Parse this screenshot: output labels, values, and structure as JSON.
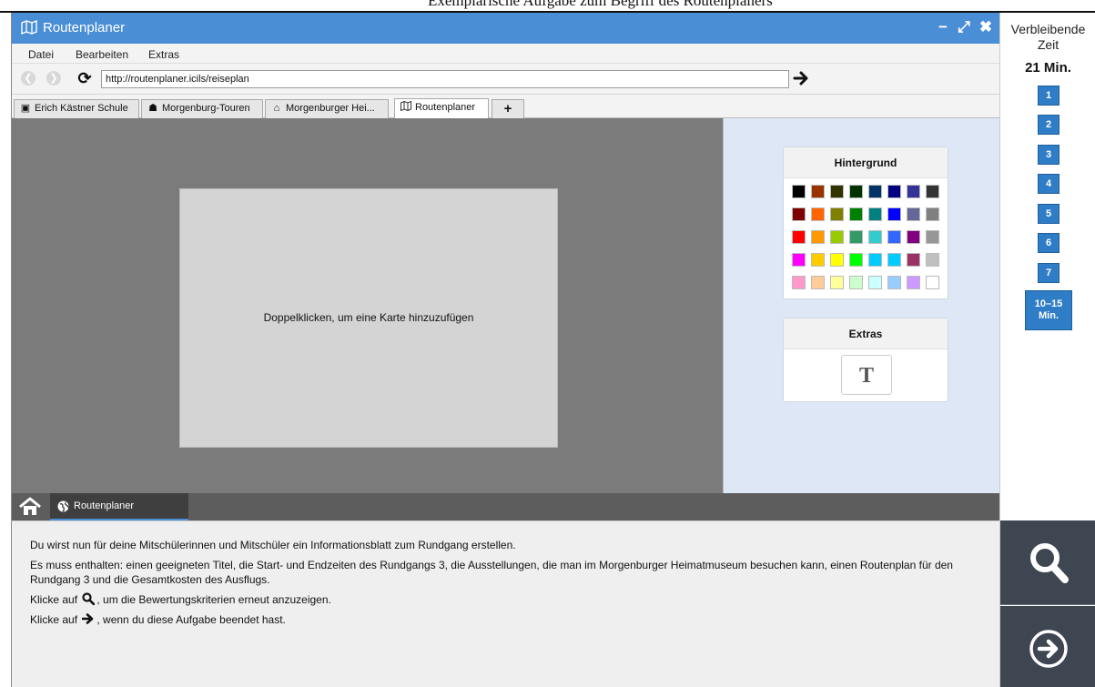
{
  "header_fragment": "Exemplarische Aufgabe zum Begriff des Routenplaners",
  "window": {
    "title": "Routenplaner",
    "controls": {
      "minimize": "−",
      "maximize": "⤢",
      "close": "✖"
    }
  },
  "menu": {
    "file": "Datei",
    "edit": "Bearbeiten",
    "extras": "Extras"
  },
  "address_bar": {
    "url": "http://routenplaner.icils/reiseplan"
  },
  "tabs": [
    {
      "icon": "bus-icon",
      "label": "Erich Kästner Schule"
    },
    {
      "icon": "tour-guide-icon",
      "label": "Morgenburg-Touren"
    },
    {
      "icon": "museum-icon",
      "label": "Morgenburger Hei..."
    },
    {
      "icon": "map-icon",
      "label": "Routenplaner"
    }
  ],
  "new_tab_label": "+",
  "map_card": {
    "text": "Doppelklicken, um eine Karte hinzuzufügen"
  },
  "background_panel": {
    "title": "Hintergrund",
    "colors": [
      [
        "#000000",
        "#993300",
        "#333300",
        "#003300",
        "#003366",
        "#000080",
        "#333399",
        "#333333"
      ],
      [
        "#800000",
        "#ff6600",
        "#808000",
        "#008000",
        "#008080",
        "#0000ff",
        "#666699",
        "#808080"
      ],
      [
        "#ff0000",
        "#ff9900",
        "#99cc00",
        "#339966",
        "#33cccc",
        "#3366ff",
        "#800080",
        "#969696"
      ],
      [
        "#ff00ff",
        "#ffcc00",
        "#ffff00",
        "#00ff00",
        "#00ccff",
        "#00ccff",
        "#993366",
        "#c0c0c0"
      ],
      [
        "#ff99cc",
        "#ffcc99",
        "#ffff99",
        "#ccffcc",
        "#ccffff",
        "#99ccff",
        "#cc99ff",
        "#ffffff"
      ]
    ]
  },
  "extras_panel": {
    "title": "Extras",
    "text_tool": "T"
  },
  "taskbar": {
    "tab_label": "Routenplaner"
  },
  "instructions": {
    "line1": "Du wirst nun für deine Mitschülerinnen und Mitschüler ein Informationsblatt zum Rundgang erstellen.",
    "line2": "Es muss enthalten: einen geeigneten Titel, die Start- und Endzeiten des Rundgangs 3, die Ausstellungen, die man im Morgenburger Heimatmuseum besuchen kann, einen Routenplan für den Rundgang 3 und die Gesamtkosten des Ausflugs.",
    "line3_before": "Klicke auf",
    "line3_after": ", um die Bewertungskriterien erneut anzuzeigen.",
    "line4_before": "Klicke auf",
    "line4_after": ", wenn du diese Aufgabe beendet hast."
  },
  "sidebar": {
    "timer_label_line1": "Verbleibende",
    "timer_label_line2": "Zeit",
    "timer_value": "21 Min.",
    "task_numbers": [
      "1",
      "2",
      "3",
      "4",
      "5",
      "6",
      "7"
    ],
    "extra_line1": "10–15",
    "extra_line2": "Min."
  },
  "accent_color": "#4a8ed6",
  "nav_color": "#2f7dc6",
  "dark_button_color": "#3e4651"
}
